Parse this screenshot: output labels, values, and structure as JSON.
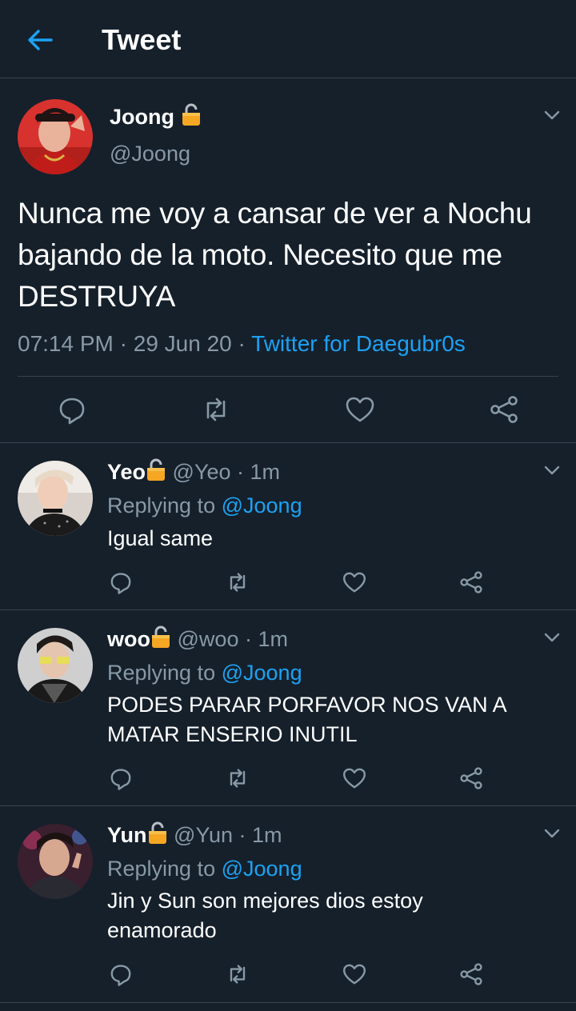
{
  "header": {
    "title": "Tweet"
  },
  "main_tweet": {
    "name": "Joong",
    "handle": "@Joong",
    "text": "Nunca me voy a cansar de ver a Nochu bajando de la moto. Necesito que me DESTRUYA",
    "time": "07:14 PM",
    "date": "29 Jun 20",
    "source": "Twitter for Daegubr0s"
  },
  "replies": [
    {
      "name": "Yeo",
      "handle": "@Yeo",
      "age": "1m",
      "replying_prefix": "Replying to",
      "replying_to": "@Joong",
      "text": "Igual same"
    },
    {
      "name": "woo",
      "handle": "@woo",
      "age": "1m",
      "replying_prefix": "Replying to",
      "replying_to": "@Joong",
      "text": "PODES PARAR PORFAVOR NOS VAN A MATAR ENSERIO INUTIL"
    },
    {
      "name": "Yun",
      "handle": "@Yun",
      "age": "1m",
      "replying_prefix": "Replying to",
      "replying_to": "@Joong",
      "text": "Jin y Sun son mejores dios estoy enamorado"
    }
  ],
  "icons": {
    "back": "arrow-left-icon",
    "lock": "lock-icon",
    "more": "chevron-down-icon",
    "reply": "reply-icon",
    "retweet": "retweet-icon",
    "like": "heart-icon",
    "share": "share-icon"
  },
  "colors": {
    "background": "#15202b",
    "accent": "#1da1f2",
    "muted": "#8899a6",
    "divider": "#38444d",
    "lock": "#f5a623"
  }
}
